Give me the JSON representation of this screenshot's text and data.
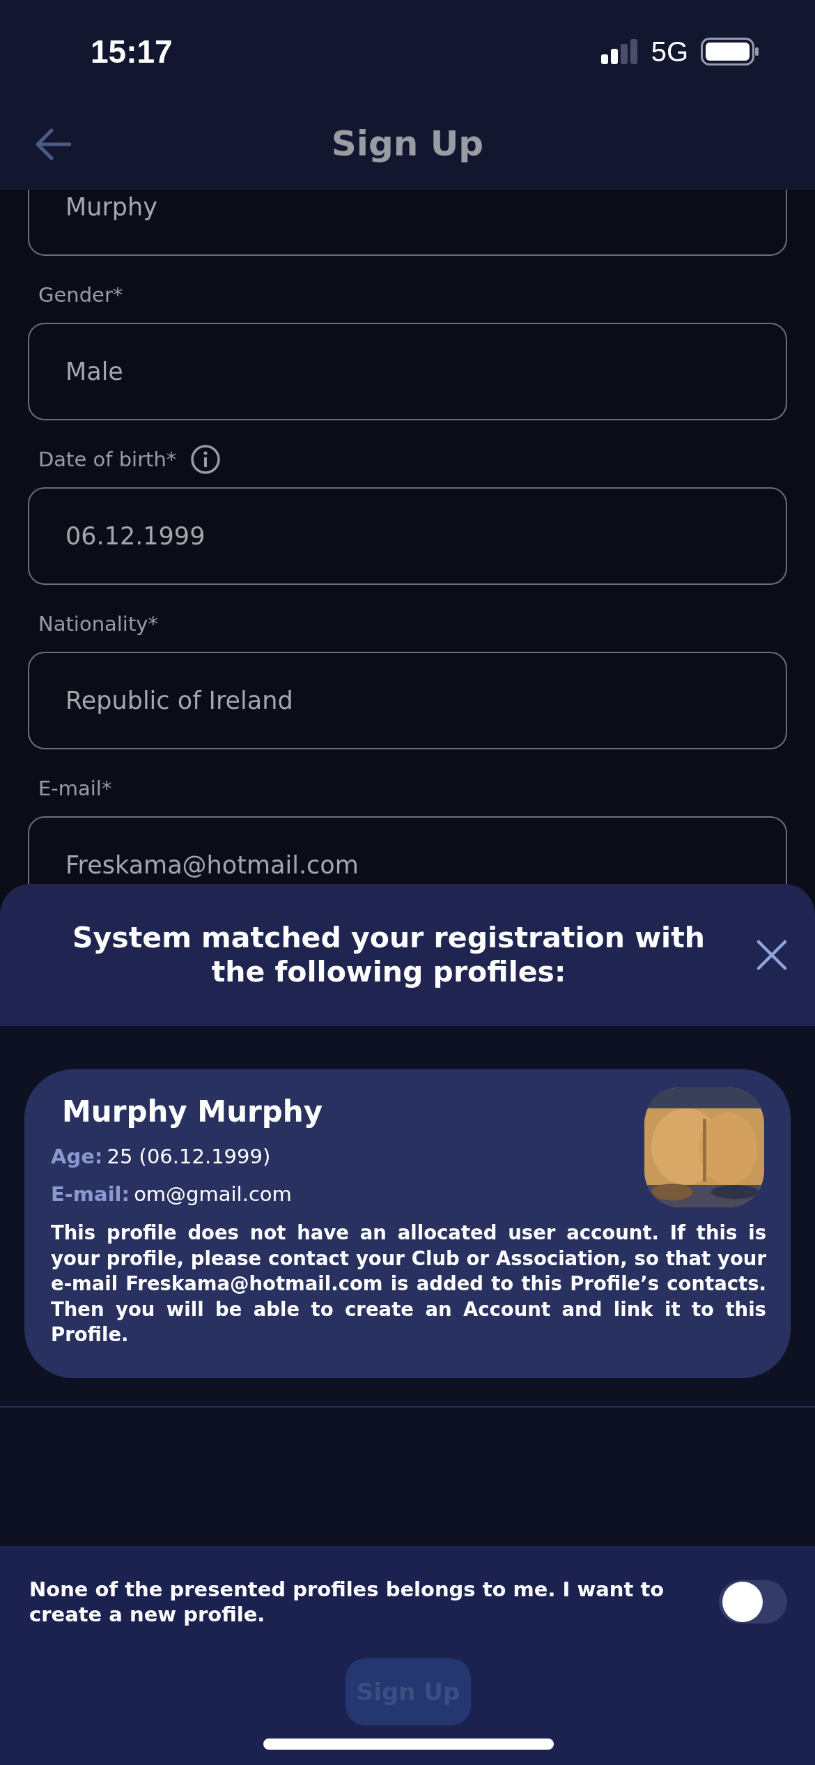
{
  "status_bar": {
    "time": "15:17",
    "network": "5G"
  },
  "header": {
    "title": "Sign Up"
  },
  "fields": [
    {
      "value": "Murphy"
    },
    {
      "label": "Gender*",
      "value": "Male"
    },
    {
      "label": "Date of birth*",
      "value": "06.12.1999",
      "has_info": true
    },
    {
      "label": "Nationality*",
      "value": "Republic of Ireland"
    },
    {
      "label": "E-mail*",
      "value": "Freskama@hotmail.com"
    }
  ],
  "modal": {
    "title": "System matched your registration with the following profiles:",
    "profiles": [
      {
        "name": "Murphy Murphy",
        "age_label": "Age:",
        "age": "25 (06.12.1999)",
        "email_label": "E-mail:",
        "email": "om@gmail.com",
        "note": "This profile does not have an allocated user account. If this is your profile, please contact your Club or Association, so that your e-mail Freskama@hotmail.com is added to this Profile’s contacts. Then you will be able to create an Account and link it to this Profile."
      }
    ],
    "toggle": {
      "label": "None of the presented profiles belongs to me. I want to create a new profile.",
      "on": false
    },
    "button": {
      "label": "Sign Up",
      "disabled": true
    }
  }
}
